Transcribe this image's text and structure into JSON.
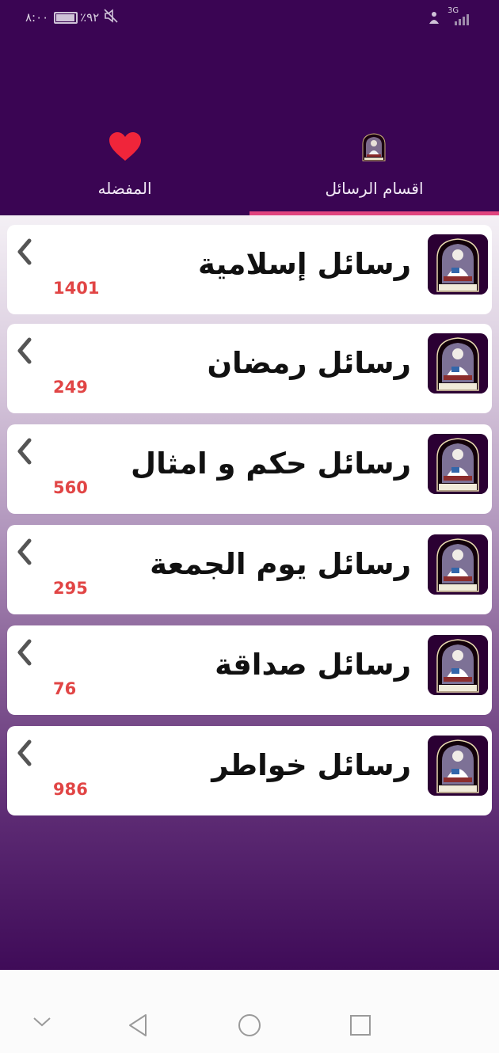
{
  "status_bar": {
    "time": "٨:٠٠",
    "battery": "٪٩٢",
    "network": "3G"
  },
  "tabs": [
    {
      "label": "المفضله",
      "icon": "heart-icon"
    },
    {
      "label": "اقسام الرسائل",
      "icon": "app-logo-icon",
      "active": true
    }
  ],
  "categories": [
    {
      "title": "رسائل إسلامية",
      "count": "1401"
    },
    {
      "title": "رسائل رمضان",
      "count": "249"
    },
    {
      "title": "رسائل حكم و امثال",
      "count": "560"
    },
    {
      "title": "رسائل يوم الجمعة",
      "count": "295"
    },
    {
      "title": "رسائل صداقة",
      "count": "76"
    },
    {
      "title": "رسائل خواطر",
      "count": "986"
    }
  ],
  "colors": {
    "header_bg": "#3a0553",
    "indicator": "#e0447e",
    "count_text": "#e14545",
    "heart": "#f0253a"
  },
  "nav_bar": [
    "chevron-down-icon",
    "back-triangle-icon",
    "home-circle-icon",
    "recents-square-icon"
  ]
}
